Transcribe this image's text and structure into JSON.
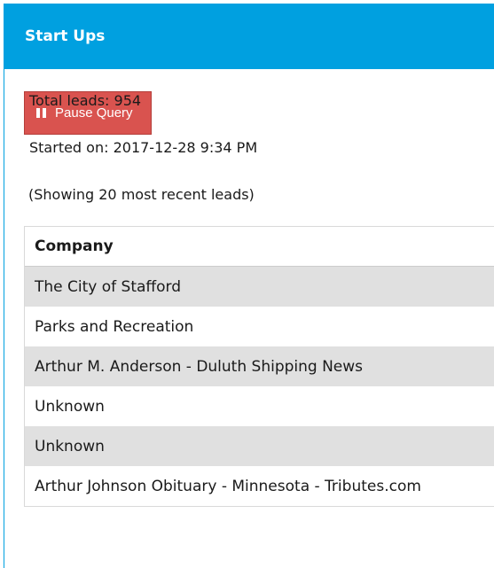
{
  "panel": {
    "title": "Start Ups"
  },
  "controls": {
    "pause_label": "Pause Query"
  },
  "stats": {
    "total_leads": "Total leads: 954",
    "started_on": "Started on: 2017-12-28 9:34 PM",
    "showing": "(Showing 20 most recent leads)"
  },
  "table": {
    "header": "Company",
    "rows": [
      "The City of Stafford",
      "Parks and Recreation",
      "Arthur M. Anderson - Duluth Shipping News",
      "Unknown",
      "Unknown",
      "Arthur Johnson Obituary - Minnesota - Tributes.com"
    ]
  },
  "colors": {
    "accent": "#00a0e0",
    "danger": "#d9534f",
    "stripe": "#e0e0e0"
  }
}
